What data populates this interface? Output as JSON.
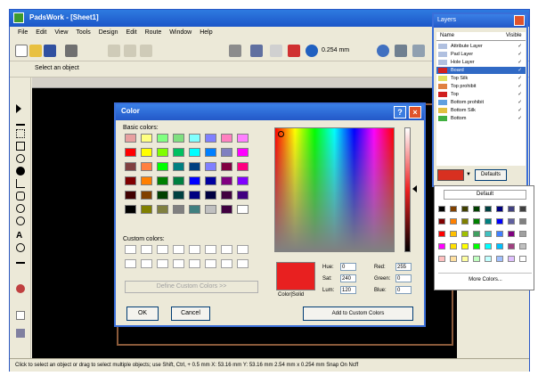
{
  "window": {
    "title": "PadsWork - [Sheet1]",
    "menu": [
      "File",
      "Edit",
      "View",
      "Tools",
      "Design",
      "Edit",
      "Route",
      "Window",
      "Help"
    ]
  },
  "toolbar": {
    "select_label": "Select an object",
    "units": "0.254 mm"
  },
  "status_bar": "Click to select an object or drag to select multiple objects; use Shift, Ctrl, + 0.5 mm X: 53.16 mm Y: 53.16 mm  2.54 mm x 0.254 mm  Snap On  Ncff",
  "color_dialog": {
    "title": "Color",
    "basic_colors_label": "Basic colors:",
    "custom_colors_label": "Custom colors:",
    "define_button": "Define Custom Colors >>",
    "ok": "OK",
    "cancel": "Cancel",
    "preview_label": "Color|Solid",
    "hue_label": "Hue:",
    "hue": "0",
    "sat_label": "Sat:",
    "sat": "240",
    "lum_label": "Lum:",
    "lum": "120",
    "red_label": "Red:",
    "red": "255",
    "green_label": "Green:",
    "green": "0",
    "blue_label": "Blue:",
    "blue": "0",
    "add_button": "Add to Custom Colors",
    "basic_colors": [
      "#e8a0a0",
      "#ffff80",
      "#80ff80",
      "#80e080",
      "#80ffff",
      "#8080ff",
      "#ff80c0",
      "#ff80ff",
      "#ff0000",
      "#ffff00",
      "#80ff00",
      "#00c060",
      "#00ffff",
      "#0080ff",
      "#8080c0",
      "#ff00ff",
      "#804040",
      "#ff8040",
      "#00ff00",
      "#008080",
      "#004080",
      "#8080ff",
      "#800040",
      "#ff0080",
      "#800000",
      "#ff8000",
      "#008000",
      "#008040",
      "#0000ff",
      "#0000a0",
      "#800080",
      "#8000ff",
      "#400000",
      "#804000",
      "#004000",
      "#004040",
      "#000080",
      "#000040",
      "#400040",
      "#400080",
      "#000000",
      "#808000",
      "#808040",
      "#808080",
      "#408080",
      "#c0c0c0",
      "#400040",
      "#ffffff"
    ]
  },
  "layers_panel": {
    "title": "Layers",
    "col_name": "Name",
    "col_visible": "Visible",
    "defaults": "Defaults",
    "layers": [
      {
        "name": "Attribute Layer",
        "color": "#b0c0e0"
      },
      {
        "name": "Pad Layer",
        "color": "#b0c0e0"
      },
      {
        "name": "Hole Layer",
        "color": "#b0c0e0"
      },
      {
        "name": "Board",
        "color": "#d02020"
      },
      {
        "name": "Top Silk",
        "color": "#e0e060"
      },
      {
        "name": "Top prohibit",
        "color": "#e08040"
      },
      {
        "name": "Top",
        "color": "#d02020"
      },
      {
        "name": "Bottom prohibit",
        "color": "#60a0e0"
      },
      {
        "name": "Bottom Silk",
        "color": "#e0c040"
      },
      {
        "name": "Bottom",
        "color": "#40b040"
      }
    ],
    "checkmark": "✓"
  },
  "color_dropdown": {
    "default_label": "Default",
    "more_colors": "More Colors...",
    "colors": [
      "#000000",
      "#804000",
      "#404000",
      "#004000",
      "#004040",
      "#000080",
      "#404080",
      "#404040",
      "#800000",
      "#ff8000",
      "#808000",
      "#008000",
      "#008080",
      "#0000ff",
      "#6060a0",
      "#808080",
      "#ff0000",
      "#ffc000",
      "#a0c000",
      "#40a060",
      "#40c0c0",
      "#4080ff",
      "#800080",
      "#a0a0a0",
      "#ff00ff",
      "#ffe000",
      "#ffff00",
      "#00ff00",
      "#00ffff",
      "#00c0ff",
      "#a04080",
      "#c0c0c0",
      "#ffc0c0",
      "#ffe0a0",
      "#ffffa0",
      "#c0ffc0",
      "#c0ffff",
      "#a0c0ff",
      "#e0c0ff",
      "#ffffff"
    ]
  }
}
